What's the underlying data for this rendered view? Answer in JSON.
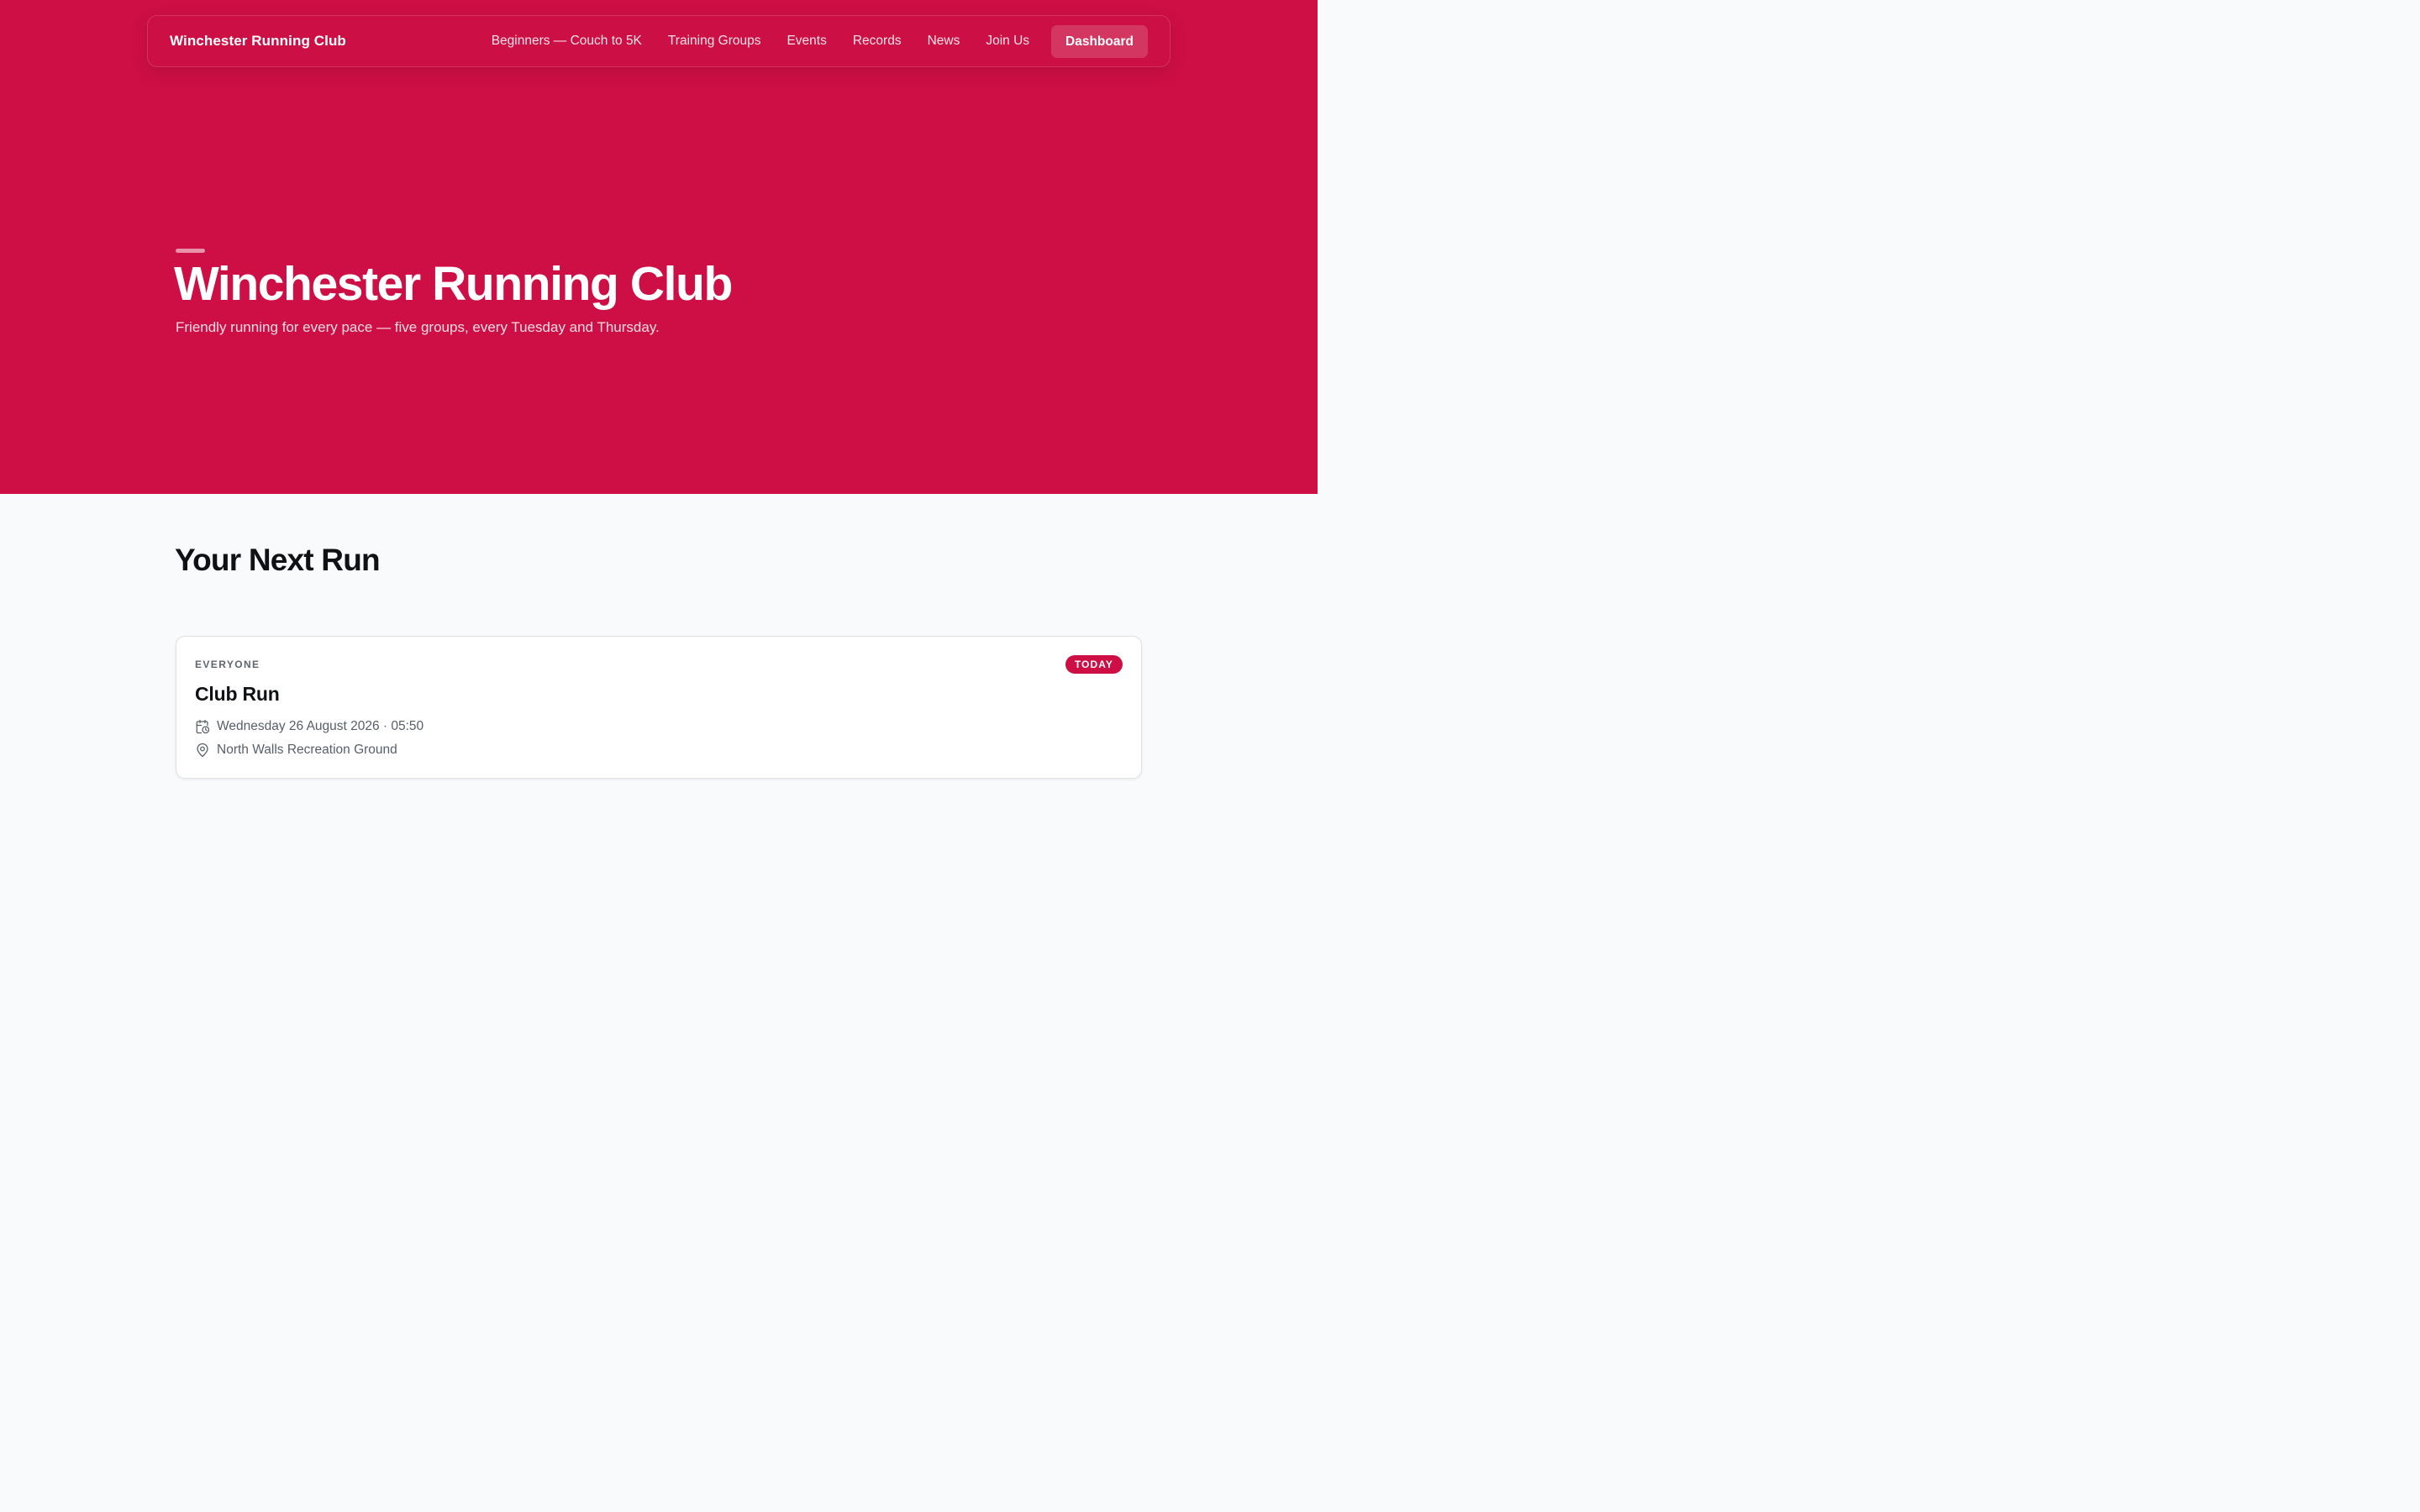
{
  "header": {
    "brand": "Winchester Running Club",
    "nav": [
      {
        "label": "Beginners — Couch to 5K"
      },
      {
        "label": "Training Groups"
      },
      {
        "label": "Events"
      },
      {
        "label": "Records"
      },
      {
        "label": "News"
      },
      {
        "label": "Join Us"
      }
    ],
    "dashboard_label": "Dashboard"
  },
  "hero": {
    "title": "Winchester Running Club",
    "subtitle": "Friendly running for every pace — five groups, every Tuesday and Thursday."
  },
  "next_run": {
    "section_title": "Your Next Run",
    "card": {
      "group": "EVERYONE",
      "badge": "TODAY",
      "title": "Club Run",
      "datetime": "Wednesday 26 August 2026 · 05:50",
      "location": "North Walls Recreation Ground",
      "date_icon": "calendar-clock-icon",
      "location_icon": "map-pin-icon"
    }
  },
  "colors": {
    "brand": "#cd0f45",
    "page_background": "#f9fafb",
    "card_background": "#ffffff",
    "text_dark": "#0f1115",
    "text_muted": "#585e69"
  }
}
